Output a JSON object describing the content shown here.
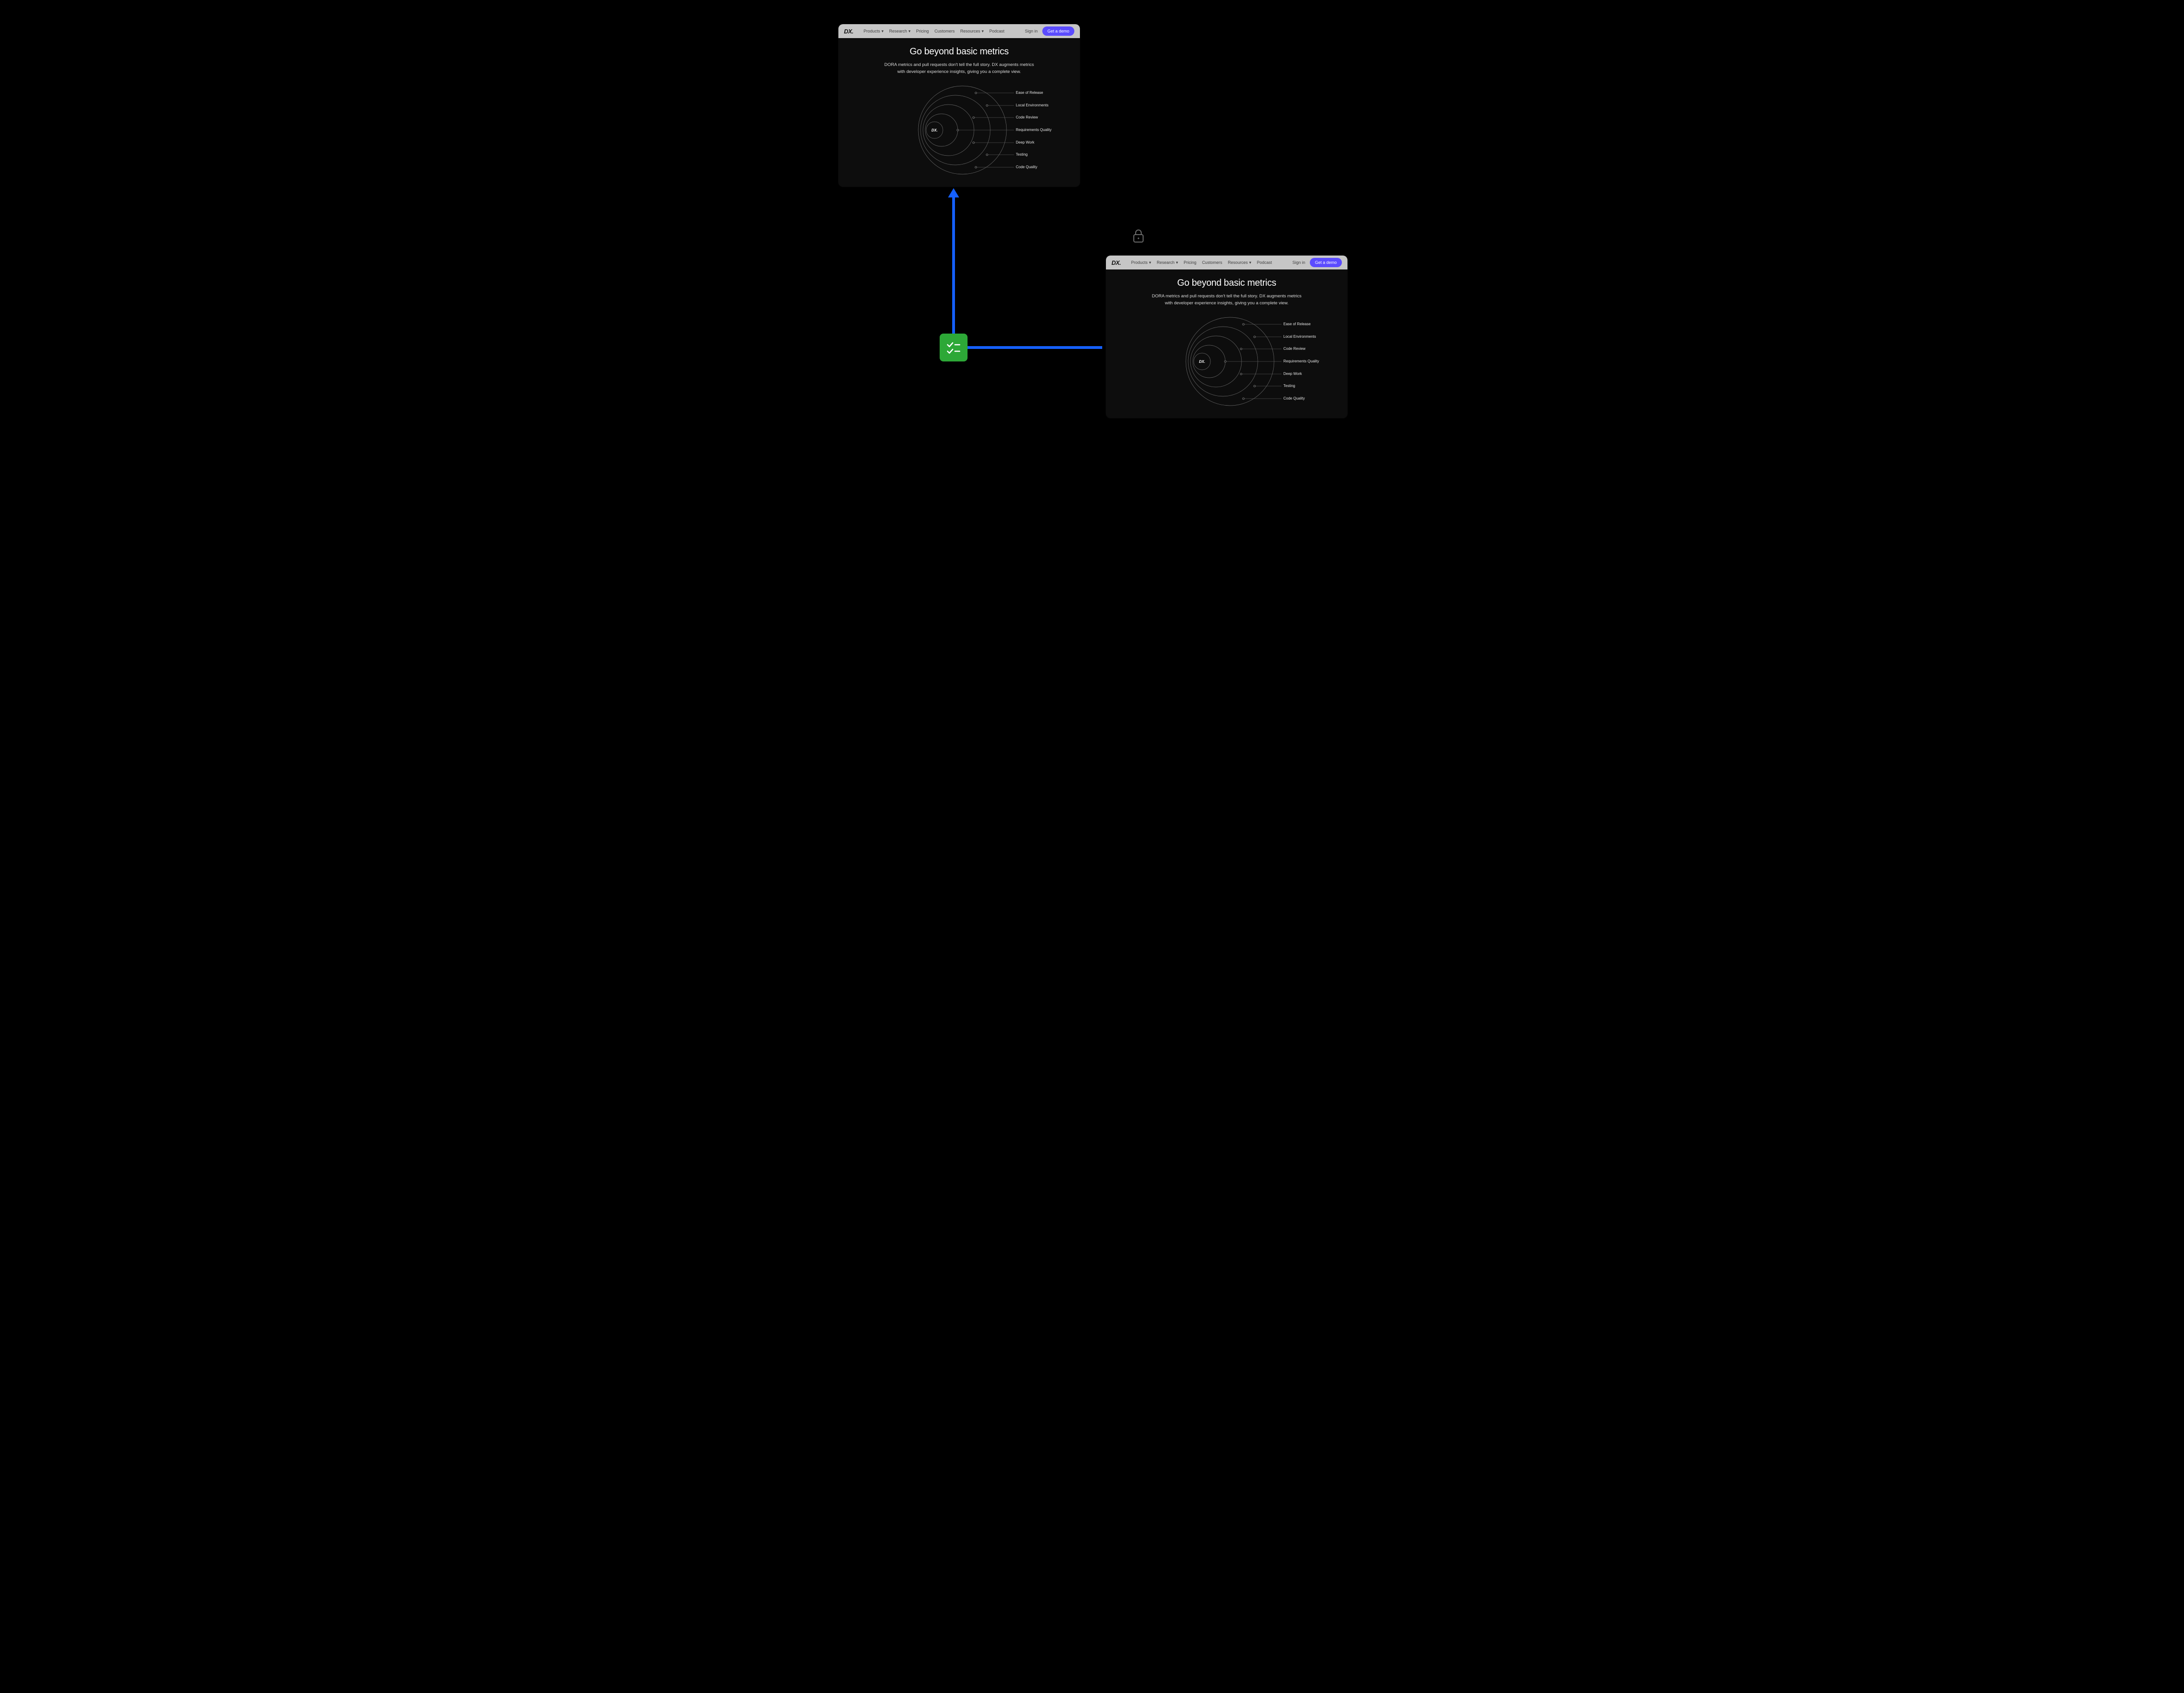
{
  "nav": {
    "logo": "DX.",
    "items": [
      {
        "label": "Products",
        "dropdown": true
      },
      {
        "label": "Research",
        "dropdown": true
      },
      {
        "label": "Pricing",
        "dropdown": false
      },
      {
        "label": "Customers",
        "dropdown": false
      },
      {
        "label": "Resources",
        "dropdown": true
      },
      {
        "label": "Podcast",
        "dropdown": false
      }
    ],
    "signin": "Sign in",
    "demo_cta": "Get a demo"
  },
  "hero": {
    "title": "Go beyond basic metrics",
    "subtitle": "DORA metrics and pull requests don't tell the full story. DX augments metrics with developer experience insights, giving you a complete view."
  },
  "orbit_center": "DX.",
  "orbit_labels": [
    "Ease of Release",
    "Local Environments",
    "Code Review",
    "Requirements Quality",
    "Deep Work",
    "Testing",
    "Code Quality"
  ],
  "diagram": {
    "source_icon": "checklist-badge",
    "lock_icon": "lock-icon",
    "cards": [
      "top-left",
      "bottom-right"
    ]
  }
}
